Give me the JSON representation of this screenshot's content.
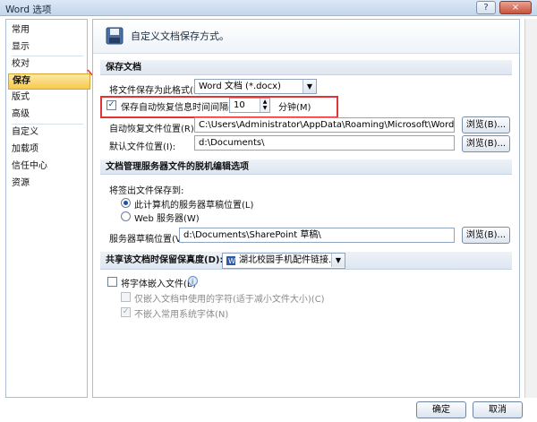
{
  "window": {
    "title": "Word 选项",
    "help": "?",
    "close": "×"
  },
  "sidebar": {
    "items": [
      "常用",
      "显示",
      "校对",
      "保存",
      "版式",
      "高级",
      "自定义",
      "加载项",
      "信任中心",
      "资源"
    ],
    "selected": "保存"
  },
  "header": {
    "text": "自定义文档保存方式。"
  },
  "save_docs": {
    "heading": "保存文档",
    "format_label": "将文件保存为此格式(F):",
    "format_value": "Word 文档 (*.docx)",
    "autorecover_label": "保存自动恢复信息时间间隔(A)",
    "autorecover_value": "10",
    "autorecover_unit": "分钟(M)",
    "autorecover_loc_label": "自动恢复文件位置(R):",
    "autorecover_loc_value": "C:\\Users\\Administrator\\AppData\\Roaming\\Microsoft\\Word\\",
    "default_loc_label": "默认文件位置(I):",
    "default_loc_value": "d:\\Documents\\",
    "browse1": "浏览(B)...",
    "browse2": "浏览(B)..."
  },
  "offline": {
    "heading": "文档管理服务器文件的脱机编辑选项",
    "save_to_label": "将签出文件保存到:",
    "radio1": "此计算机的服务器草稿位置(L)",
    "radio2": "Web 服务器(W)",
    "drafts_label": "服务器草稿位置(V):",
    "drafts_value": "d:\\Documents\\SharePoint 草稿\\",
    "browse3": "浏览(B)..."
  },
  "fidelity": {
    "heading": "共享该文档时保留保真度(D):",
    "doc_value": "湖北校园手机配件链接.docx",
    "embed_label": "将字体嵌入文件(E)",
    "subset_label": "仅嵌入文档中使用的字符(适于减小文件大小)(C)",
    "no_common_label": "不嵌入常用系统字体(N)"
  },
  "footer": {
    "ok": "确定",
    "cancel": "取消"
  },
  "colors": {
    "accent": "#f7c94f",
    "highlight": "#e23434"
  }
}
